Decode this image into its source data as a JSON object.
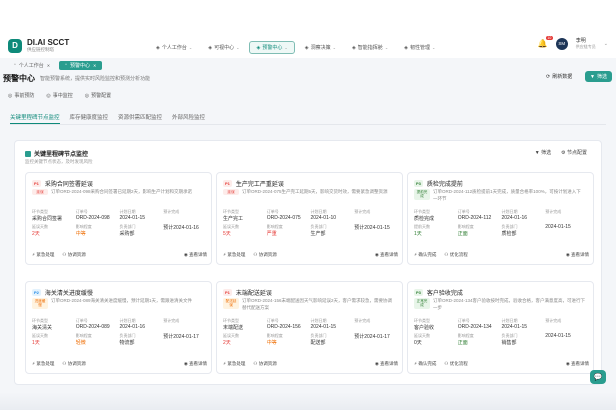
{
  "app": {
    "logo_mark": "D",
    "name": "DI.AI SCCT",
    "subtitle": "供应链控制塔"
  },
  "nav": [
    {
      "label": "个人工作台",
      "icon": "home-icon",
      "active": false
    },
    {
      "label": "可视中心",
      "icon": "eye-icon",
      "active": false
    },
    {
      "label": "预警中心",
      "icon": "alert-icon",
      "active": true
    },
    {
      "label": "洞察决策",
      "icon": "insight-icon",
      "active": false
    },
    {
      "label": "智能指挥舱",
      "icon": "cockpit-icon",
      "active": false
    },
    {
      "label": "韧性管理",
      "icon": "shield-icon",
      "active": false
    }
  ],
  "user": {
    "badge": "10",
    "avatar": "SM",
    "name": "李明",
    "role": "供应链专员"
  },
  "page_tabs": [
    {
      "label": "个人工作台",
      "active": false
    },
    {
      "label": "预警中心",
      "active": true
    }
  ],
  "page": {
    "title": "预警中心",
    "subtitle": "智能预警系统，提供实时风险监控和预测分析功能",
    "refresh_label": "刷新数据",
    "filter_label": "筛选"
  },
  "quick": [
    "事前预防",
    "事中监控",
    "预警配置"
  ],
  "main_tabs": [
    {
      "label": "关键里程碑节点监控",
      "active": true
    },
    {
      "label": "库存健康度监控",
      "active": false
    },
    {
      "label": "资源供需匹配监控",
      "active": false
    },
    {
      "label": "外部风险监控",
      "active": false
    }
  ],
  "panel": {
    "title": "关键里程碑节点监控",
    "desc": "监控关键节点状态，及时发现风险",
    "filter": "筛选",
    "config": "节点配置"
  },
  "cards": [
    {
      "priority": "P1",
      "level": "p1",
      "title": "采购合同签署延误",
      "status": "延误",
      "status_color": "red",
      "desc": "订单ORD-2024-098采购合同签署已延期2天，影响生产计划和交期承诺",
      "fields": [
        {
          "label": "环节类型",
          "value": "采购合同签署",
          "color": ""
        },
        {
          "label": "订单号",
          "value": "ORD-2024-098",
          "color": ""
        },
        {
          "label": "计划日期",
          "value": "2024-01-15",
          "color": ""
        },
        {
          "label": "预计完成",
          "value": "",
          "color": ""
        },
        {
          "label": "延误天数",
          "value": "2天",
          "color": "red"
        },
        {
          "label": "影响程度",
          "value": "中等",
          "color": "orange"
        },
        {
          "label": "负责部门",
          "value": "采购部",
          "color": ""
        },
        {
          "label": "",
          "value": "预计2024-01-16",
          "color": ""
        }
      ],
      "actions": [
        "紧急处理",
        "协调资源",
        "查看详情"
      ]
    },
    {
      "priority": "P1",
      "level": "p1",
      "title": "生产完工严重延误",
      "status": "延误",
      "status_color": "red",
      "desc": "订单ORD-2024-075生产完工延期5天，影响交货时效，需要紧急调整资源",
      "fields": [
        {
          "label": "环节类型",
          "value": "生产完工",
          "color": ""
        },
        {
          "label": "订单号",
          "value": "ORD-2024-075",
          "color": ""
        },
        {
          "label": "计划日期",
          "value": "2024-01-10",
          "color": ""
        },
        {
          "label": "预计完成",
          "value": "",
          "color": ""
        },
        {
          "label": "延误天数",
          "value": "5天",
          "color": "red"
        },
        {
          "label": "影响程度",
          "value": "严重",
          "color": "red"
        },
        {
          "label": "负责部门",
          "value": "生产部",
          "color": ""
        },
        {
          "label": "",
          "value": "预计2024-01-15",
          "color": ""
        }
      ],
      "actions": [
        "紧急处理",
        "协调资源",
        "查看详情"
      ]
    },
    {
      "priority": "P3",
      "level": "p3",
      "title": "质检完成提前",
      "status": "提前完成",
      "status_color": "green",
      "desc": "订单ORD-2024-112质检提前1天完成，质量合格率100%，可按计划进入下一环节",
      "fields": [
        {
          "label": "环节类型",
          "value": "质检完成",
          "color": ""
        },
        {
          "label": "订单号",
          "value": "ORD-2024-112",
          "color": ""
        },
        {
          "label": "计划日期",
          "value": "2024-01-16",
          "color": ""
        },
        {
          "label": "预计完成",
          "value": "",
          "color": ""
        },
        {
          "label": "提前天数",
          "value": "1天",
          "color": "green"
        },
        {
          "label": "影响程度",
          "value": "正面",
          "color": "green"
        },
        {
          "label": "负责部门",
          "value": "质检部",
          "color": ""
        },
        {
          "label": "",
          "value": "2024-01-15",
          "color": ""
        }
      ],
      "actions": [
        "确认完成",
        "优化流程",
        "查看详情"
      ]
    },
    {
      "priority": "P2",
      "level": "p2",
      "title": "海关清关进度缓慢",
      "status": "进度缓慢",
      "status_color": "orange",
      "desc": "订单ORD-2024-089海关清关进度缓慢，预计延期1天，需跟进清关文件",
      "fields": [
        {
          "label": "环节类型",
          "value": "海关清关",
          "color": ""
        },
        {
          "label": "订单号",
          "value": "ORD-2024-089",
          "color": ""
        },
        {
          "label": "计划日期",
          "value": "2024-01-16",
          "color": ""
        },
        {
          "label": "预计完成",
          "value": "",
          "color": ""
        },
        {
          "label": "延误天数",
          "value": "1天",
          "color": "red"
        },
        {
          "label": "影响程度",
          "value": "轻微",
          "color": "orange"
        },
        {
          "label": "负责部门",
          "value": "物流部",
          "color": ""
        },
        {
          "label": "",
          "value": "预计2024-01-17",
          "color": ""
        }
      ],
      "actions": [
        "紧急处理",
        "协调资源",
        "查看详情"
      ]
    },
    {
      "priority": "P1",
      "level": "p1",
      "title": "末端配送延误",
      "status": "配送延误",
      "status_color": "orange",
      "desc": "订单ORD-2024-156末端配送因天气影响延误2天，客户需求较急，需要协调替代配送方案",
      "fields": [
        {
          "label": "环节类型",
          "value": "末端配送",
          "color": ""
        },
        {
          "label": "订单号",
          "value": "ORD-2024-156",
          "color": ""
        },
        {
          "label": "计划日期",
          "value": "2024-01-15",
          "color": ""
        },
        {
          "label": "预计完成",
          "value": "",
          "color": ""
        },
        {
          "label": "延误天数",
          "value": "2天",
          "color": "red"
        },
        {
          "label": "影响程度",
          "value": "中等",
          "color": "orange"
        },
        {
          "label": "负责部门",
          "value": "配送部",
          "color": ""
        },
        {
          "label": "",
          "value": "预计2024-01-17",
          "color": ""
        }
      ],
      "actions": [
        "紧急处理",
        "协调资源",
        "查看详情"
      ]
    },
    {
      "priority": "P3",
      "level": "p3",
      "title": "客户验收完成",
      "status": "正常完成",
      "status_color": "green",
      "desc": "订单ORD-2024-134客户验收按时完成，验收合格，客户满意度高，可进行下一步",
      "fields": [
        {
          "label": "环节类型",
          "value": "客户验收",
          "color": ""
        },
        {
          "label": "订单号",
          "value": "ORD-2024-134",
          "color": ""
        },
        {
          "label": "计划日期",
          "value": "2024-01-15",
          "color": ""
        },
        {
          "label": "预计完成",
          "value": "",
          "color": ""
        },
        {
          "label": "延误天数",
          "value": "0天",
          "color": ""
        },
        {
          "label": "影响程度",
          "value": "正面",
          "color": "green"
        },
        {
          "label": "负责部门",
          "value": "销售部",
          "color": ""
        },
        {
          "label": "",
          "value": "2024-01-15",
          "color": ""
        }
      ],
      "actions": [
        "确认完成",
        "优化流程",
        "查看详情"
      ]
    }
  ]
}
